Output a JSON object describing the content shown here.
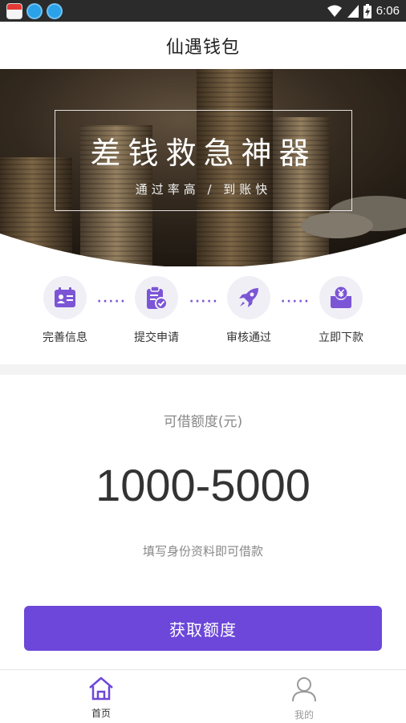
{
  "status_bar": {
    "time": "6:06",
    "notification_icons": [
      "calendar-app-icon",
      "browser-app-icon",
      "browser-app-icon"
    ]
  },
  "header": {
    "title": "仙遇钱包"
  },
  "banner": {
    "title": "差钱救急神器",
    "subtitle": "通过率高 / 到账快"
  },
  "steps": [
    {
      "label": "完善信息",
      "icon": "id-card-icon"
    },
    {
      "label": "提交申请",
      "icon": "clipboard-check-icon"
    },
    {
      "label": "审核通过",
      "icon": "rocket-icon"
    },
    {
      "label": "立即下款",
      "icon": "yuan-inbox-icon"
    }
  ],
  "loan": {
    "label": "可借额度(元)",
    "amount": "1000-5000",
    "hint": "填写身份资料即可借款"
  },
  "cta": {
    "label": "获取额度"
  },
  "tabbar": {
    "items": [
      {
        "label": "首页",
        "icon": "home-icon",
        "active": true
      },
      {
        "label": "我的",
        "icon": "user-icon",
        "active": false
      }
    ]
  },
  "colors": {
    "accent": "#6c47d9",
    "icon_bg": "#f1eff6",
    "status_bar": "#2b2b2b"
  }
}
